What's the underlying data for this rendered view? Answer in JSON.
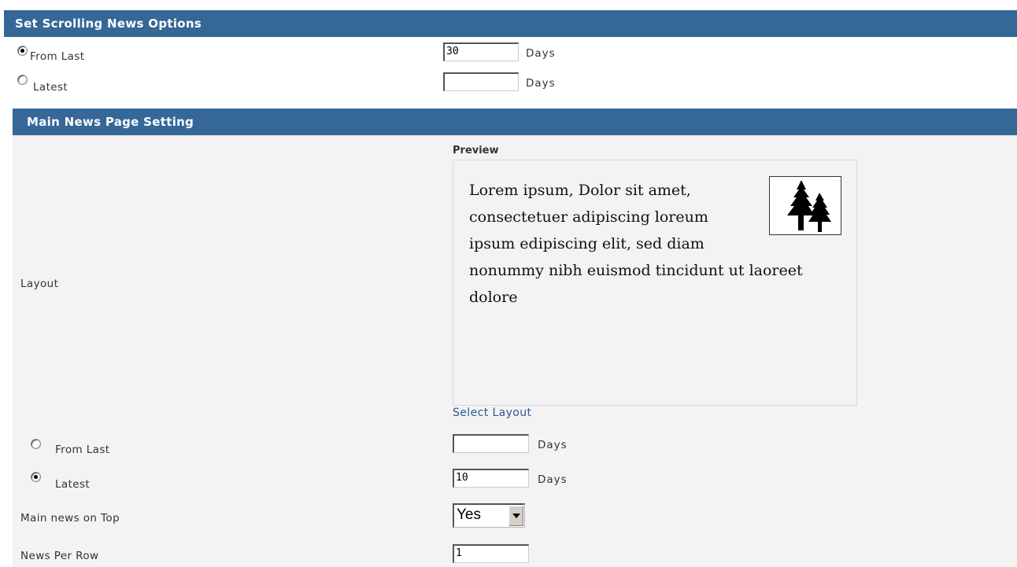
{
  "scrolling": {
    "header": "Set Scrolling News Options",
    "from_last": {
      "label": "From Last",
      "value": "30",
      "unit": "Days",
      "checked": true
    },
    "latest": {
      "label": "Latest",
      "value": "",
      "unit": "Days",
      "checked": false
    }
  },
  "main": {
    "header": "Main News Page Setting",
    "layout_label": "Layout",
    "preview_title": "Preview",
    "preview_text": "Lorem ipsum, Dolor sit amet, consectetuer adipiscing loreum ipsum edipiscing elit, sed diam nonummy nibh euismod tincidunt ut laoreet dolore",
    "preview_lines": [
      "Lorem ipsum, Dolor sit amet,",
      "consectetuer adipiscing loreum",
      "ipsum edipiscing elit, sed diam",
      "nonummy nibh euismod tincidunt ut laoreet",
      "dolore"
    ],
    "select_layout": "Select Layout",
    "from_last": {
      "label": "From Last",
      "value": "",
      "unit": "Days",
      "checked": false
    },
    "latest": {
      "label": "Latest",
      "value": "10",
      "unit": "Days",
      "checked": true
    },
    "main_news_on_top": {
      "label": "Main news on Top",
      "value": "Yes"
    },
    "news_per_row": {
      "label": "News Per Row",
      "value": "1"
    }
  },
  "colors": {
    "header_bg": "#356797",
    "panel_bg": "#f3f3f3",
    "link": "#2b5a8c"
  }
}
